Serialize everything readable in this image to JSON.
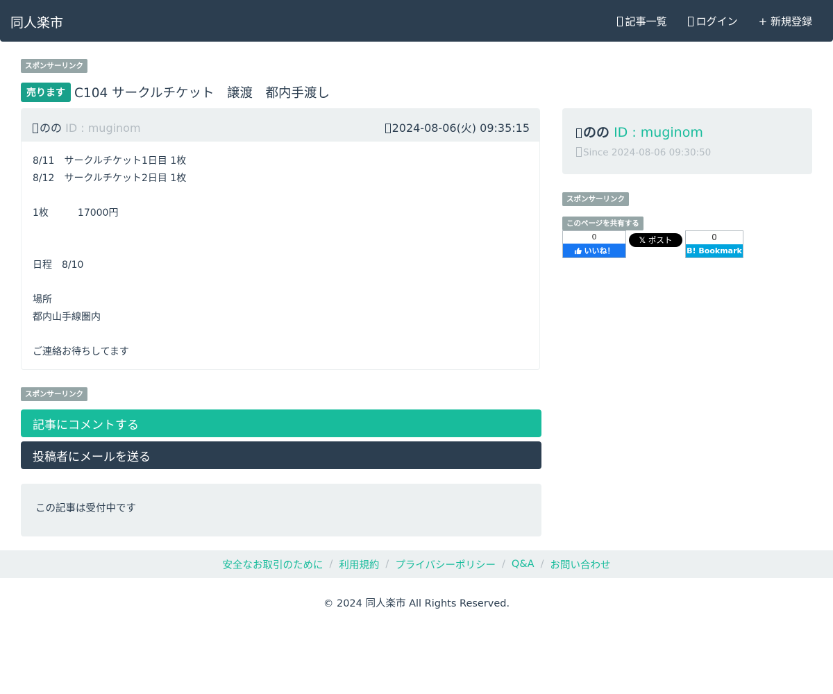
{
  "header": {
    "brand": "同人楽市",
    "nav": [
      {
        "label": "記事一覧",
        "icon": "list-icon"
      },
      {
        "label": "ログイン",
        "icon": "login-icon"
      },
      {
        "label": "+ 新規登録",
        "icon": ""
      }
    ]
  },
  "sponsor_label": "スポンサーリンク",
  "post": {
    "badge": "売ります",
    "title": "C104 サークルチケット　譲渡　都内手渡し",
    "author_name": "のの",
    "author_id": "ID : muginom",
    "date": "2024-08-06(火) 09:35:15",
    "body_lines": [
      "8/11　サークルチケット1日目 1枚",
      "8/12　サークルチケット2日目 1枚",
      "",
      "1枚　　　17000円",
      "",
      "",
      "日程　8/10",
      "",
      "場所",
      "都内山手線圏内",
      "",
      "ご連絡お待ちしてます"
    ]
  },
  "actions": {
    "comment": "記事にコメントする",
    "mail": "投稿者にメールを送る"
  },
  "status": "この記事は受付中です",
  "sidebar": {
    "name": "のの",
    "id": "ID : muginom",
    "since": "Since 2024-08-06 09:30:50",
    "share_label": "このページを共有する",
    "fb_count": "0",
    "fb_label": "いいね！",
    "x_label": "ポスト",
    "hatena_count": "0",
    "hatena_label": "B! Bookmark"
  },
  "footer": {
    "links": [
      "安全なお取引のために",
      "利用規約",
      "プライバシーポリシー",
      "Q&A",
      "お問い合わせ"
    ],
    "copyright": "© 2024 同人楽市 All Rights Reserved."
  },
  "colors": {
    "navbar": "#2c3e50",
    "accent": "#18bc9c",
    "badge": "#18a08a",
    "muted": "#b4bcc2",
    "panel_bg": "#ecf0f1"
  }
}
